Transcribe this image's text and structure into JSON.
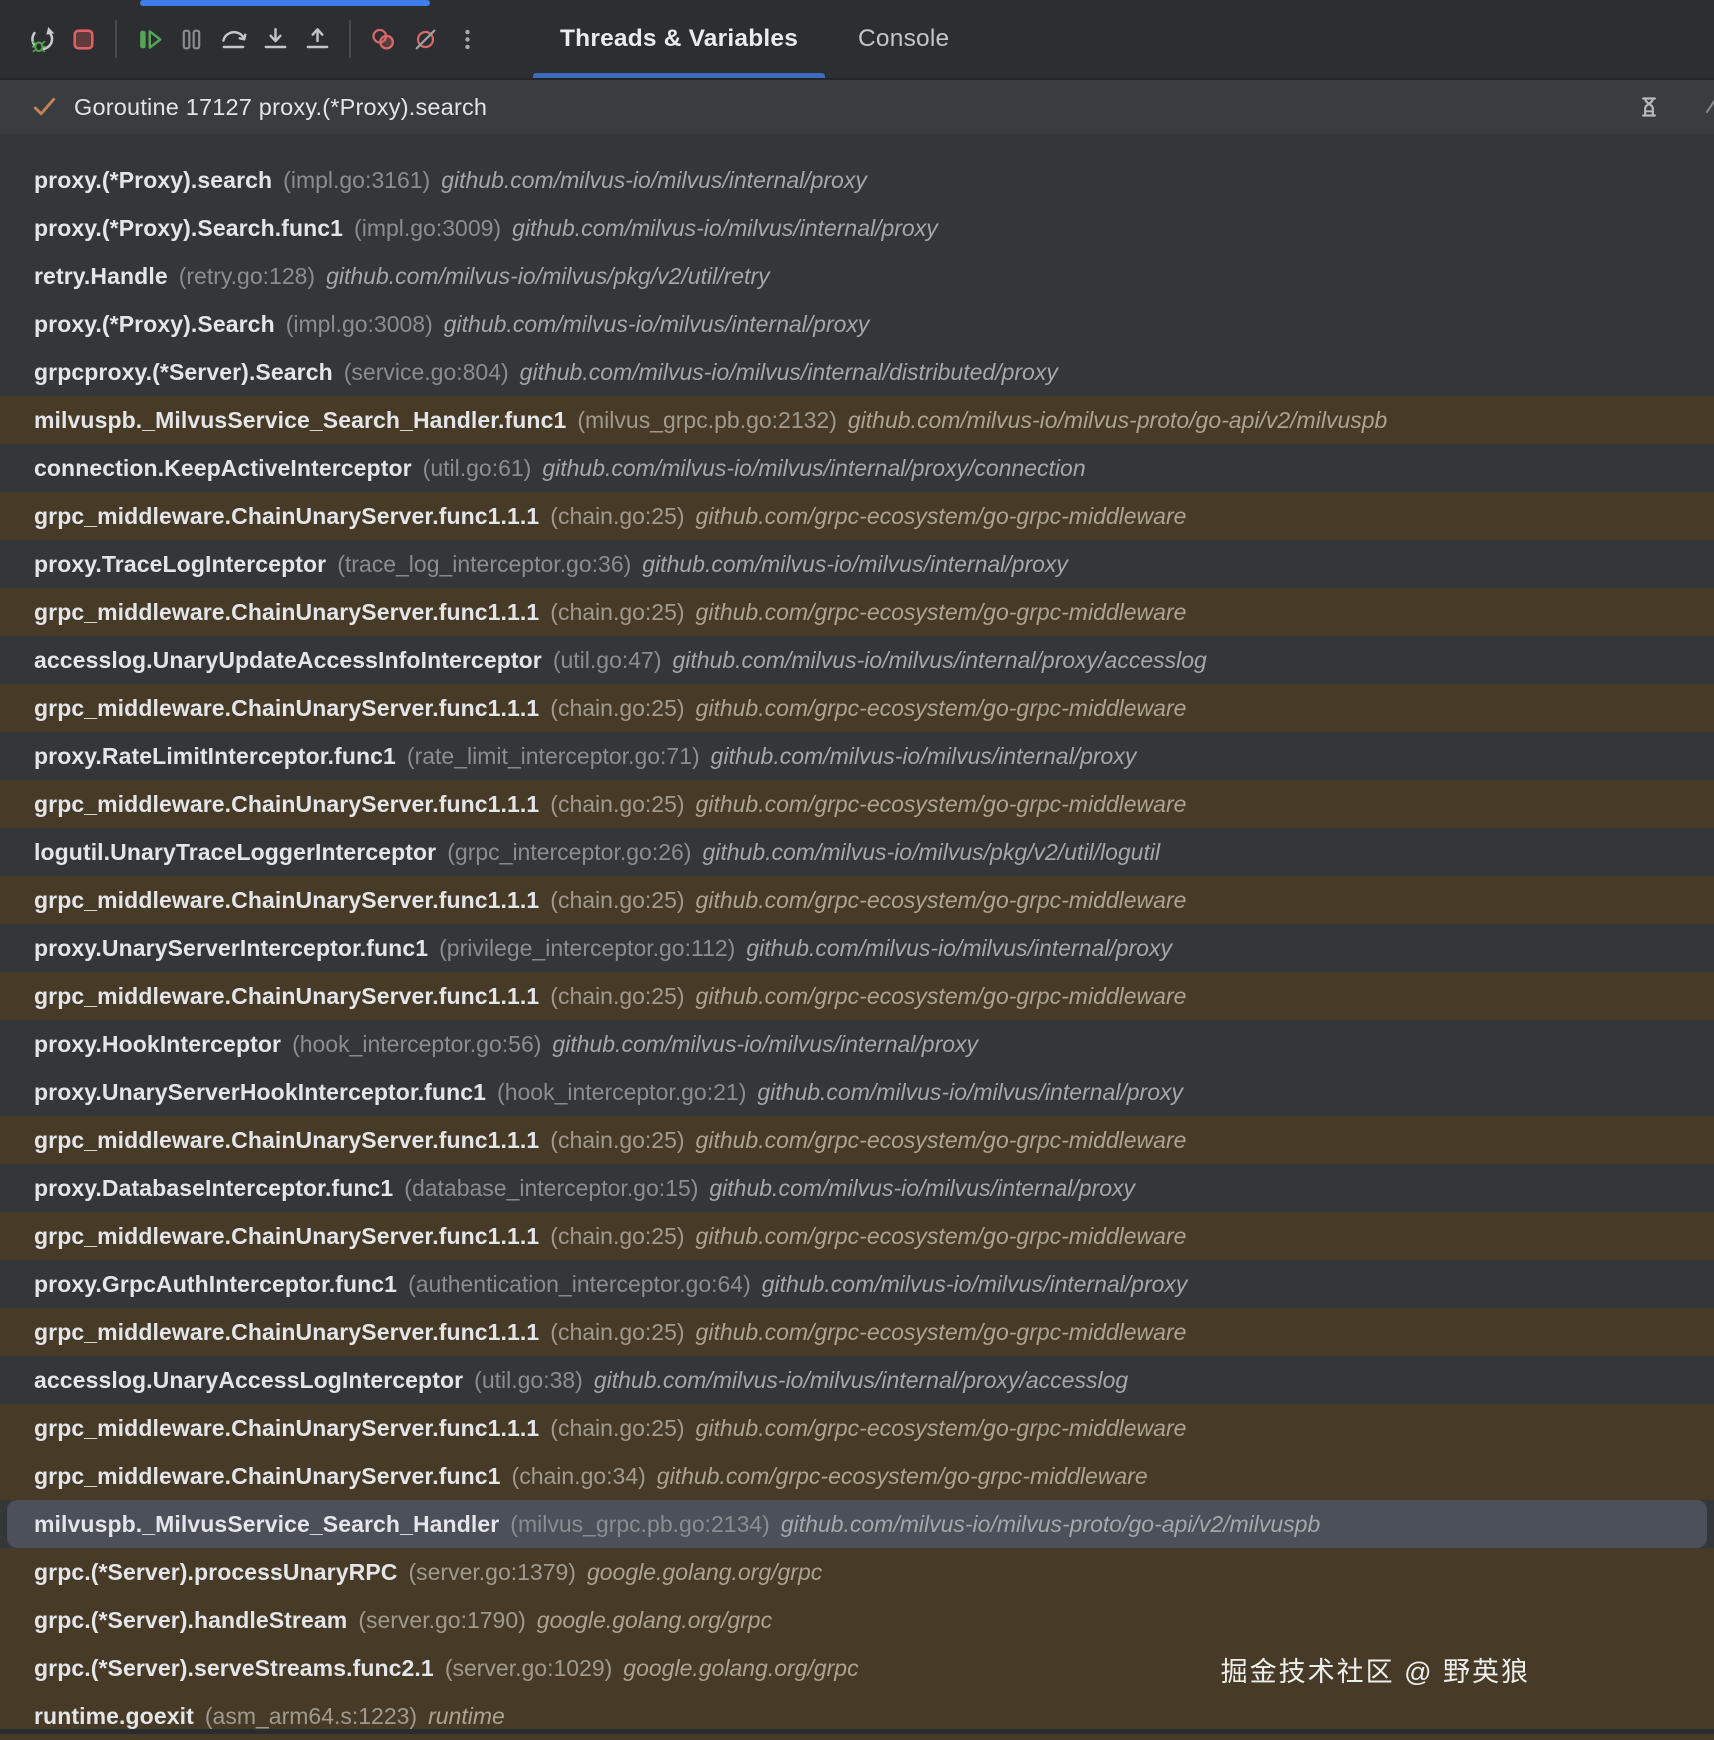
{
  "toolbar": {
    "icons": [
      "rerun-debug",
      "stop",
      "resume-program",
      "pause-program",
      "step-over",
      "step-into",
      "step-out",
      "view-breakpoints",
      "mute-breakpoints",
      "more-options"
    ],
    "tabs": [
      {
        "label": "Threads & Variables",
        "active": true
      },
      {
        "label": "Console",
        "active": false
      }
    ]
  },
  "goroutine_header": {
    "label": "Goroutine 17127 proxy.(*Proxy).search",
    "status_icon": "check-icon",
    "filter_icon": "hourglass-icon"
  },
  "frames": [
    {
      "fn": "proxy.(*Proxy).search",
      "loc": "(impl.go:3161)",
      "pkg": "github.com/milvus-io/milvus/internal/proxy",
      "bg": "dark"
    },
    {
      "fn": "proxy.(*Proxy).Search.func1",
      "loc": "(impl.go:3009)",
      "pkg": "github.com/milvus-io/milvus/internal/proxy",
      "bg": "dark"
    },
    {
      "fn": "retry.Handle",
      "loc": "(retry.go:128)",
      "pkg": "github.com/milvus-io/milvus/pkg/v2/util/retry",
      "bg": "dark"
    },
    {
      "fn": "proxy.(*Proxy).Search",
      "loc": "(impl.go:3008)",
      "pkg": "github.com/milvus-io/milvus/internal/proxy",
      "bg": "dark"
    },
    {
      "fn": "grpcproxy.(*Server).Search",
      "loc": "(service.go:804)",
      "pkg": "github.com/milvus-io/milvus/internal/distributed/proxy",
      "bg": "dark"
    },
    {
      "fn": "milvuspb._MilvusService_Search_Handler.func1",
      "loc": "(milvus_grpc.pb.go:2132)",
      "pkg": "github.com/milvus-io/milvus-proto/go-api/v2/milvuspb",
      "bg": "library"
    },
    {
      "fn": "connection.KeepActiveInterceptor",
      "loc": "(util.go:61)",
      "pkg": "github.com/milvus-io/milvus/internal/proxy/connection",
      "bg": "dark"
    },
    {
      "fn": "grpc_middleware.ChainUnaryServer.func1.1.1",
      "loc": "(chain.go:25)",
      "pkg": "github.com/grpc-ecosystem/go-grpc-middleware",
      "bg": "library"
    },
    {
      "fn": "proxy.TraceLogInterceptor",
      "loc": "(trace_log_interceptor.go:36)",
      "pkg": "github.com/milvus-io/milvus/internal/proxy",
      "bg": "dark"
    },
    {
      "fn": "grpc_middleware.ChainUnaryServer.func1.1.1",
      "loc": "(chain.go:25)",
      "pkg": "github.com/grpc-ecosystem/go-grpc-middleware",
      "bg": "library"
    },
    {
      "fn": "accesslog.UnaryUpdateAccessInfoInterceptor",
      "loc": "(util.go:47)",
      "pkg": "github.com/milvus-io/milvus/internal/proxy/accesslog",
      "bg": "dark"
    },
    {
      "fn": "grpc_middleware.ChainUnaryServer.func1.1.1",
      "loc": "(chain.go:25)",
      "pkg": "github.com/grpc-ecosystem/go-grpc-middleware",
      "bg": "library"
    },
    {
      "fn": "proxy.RateLimitInterceptor.func1",
      "loc": "(rate_limit_interceptor.go:71)",
      "pkg": "github.com/milvus-io/milvus/internal/proxy",
      "bg": "dark"
    },
    {
      "fn": "grpc_middleware.ChainUnaryServer.func1.1.1",
      "loc": "(chain.go:25)",
      "pkg": "github.com/grpc-ecosystem/go-grpc-middleware",
      "bg": "library"
    },
    {
      "fn": "logutil.UnaryTraceLoggerInterceptor",
      "loc": "(grpc_interceptor.go:26)",
      "pkg": "github.com/milvus-io/milvus/pkg/v2/util/logutil",
      "bg": "dark"
    },
    {
      "fn": "grpc_middleware.ChainUnaryServer.func1.1.1",
      "loc": "(chain.go:25)",
      "pkg": "github.com/grpc-ecosystem/go-grpc-middleware",
      "bg": "library"
    },
    {
      "fn": "proxy.UnaryServerInterceptor.func1",
      "loc": "(privilege_interceptor.go:112)",
      "pkg": "github.com/milvus-io/milvus/internal/proxy",
      "bg": "dark"
    },
    {
      "fn": "grpc_middleware.ChainUnaryServer.func1.1.1",
      "loc": "(chain.go:25)",
      "pkg": "github.com/grpc-ecosystem/go-grpc-middleware",
      "bg": "library"
    },
    {
      "fn": "proxy.HookInterceptor",
      "loc": "(hook_interceptor.go:56)",
      "pkg": "github.com/milvus-io/milvus/internal/proxy",
      "bg": "dark"
    },
    {
      "fn": "proxy.UnaryServerHookInterceptor.func1",
      "loc": "(hook_interceptor.go:21)",
      "pkg": "github.com/milvus-io/milvus/internal/proxy",
      "bg": "dark"
    },
    {
      "fn": "grpc_middleware.ChainUnaryServer.func1.1.1",
      "loc": "(chain.go:25)",
      "pkg": "github.com/grpc-ecosystem/go-grpc-middleware",
      "bg": "library"
    },
    {
      "fn": "proxy.DatabaseInterceptor.func1",
      "loc": "(database_interceptor.go:15)",
      "pkg": "github.com/milvus-io/milvus/internal/proxy",
      "bg": "dark"
    },
    {
      "fn": "grpc_middleware.ChainUnaryServer.func1.1.1",
      "loc": "(chain.go:25)",
      "pkg": "github.com/grpc-ecosystem/go-grpc-middleware",
      "bg": "library"
    },
    {
      "fn": "proxy.GrpcAuthInterceptor.func1",
      "loc": "(authentication_interceptor.go:64)",
      "pkg": "github.com/milvus-io/milvus/internal/proxy",
      "bg": "dark"
    },
    {
      "fn": "grpc_middleware.ChainUnaryServer.func1.1.1",
      "loc": "(chain.go:25)",
      "pkg": "github.com/grpc-ecosystem/go-grpc-middleware",
      "bg": "library"
    },
    {
      "fn": "accesslog.UnaryAccessLogInterceptor",
      "loc": "(util.go:38)",
      "pkg": "github.com/milvus-io/milvus/internal/proxy/accesslog",
      "bg": "dark"
    },
    {
      "fn": "grpc_middleware.ChainUnaryServer.func1.1.1",
      "loc": "(chain.go:25)",
      "pkg": "github.com/grpc-ecosystem/go-grpc-middleware",
      "bg": "library"
    },
    {
      "fn": "grpc_middleware.ChainUnaryServer.func1",
      "loc": "(chain.go:34)",
      "pkg": "github.com/grpc-ecosystem/go-grpc-middleware",
      "bg": "library"
    },
    {
      "fn": "milvuspb._MilvusService_Search_Handler",
      "loc": "(milvus_grpc.pb.go:2134)",
      "pkg": "github.com/milvus-io/milvus-proto/go-api/v2/milvuspb",
      "bg": "selected"
    },
    {
      "fn": "grpc.(*Server).processUnaryRPC",
      "loc": "(server.go:1379)",
      "pkg": "google.golang.org/grpc",
      "bg": "library"
    },
    {
      "fn": "grpc.(*Server).handleStream",
      "loc": "(server.go:1790)",
      "pkg": "google.golang.org/grpc",
      "bg": "library"
    },
    {
      "fn": "grpc.(*Server).serveStreams.func2.1",
      "loc": "(server.go:1029)",
      "pkg": "google.golang.org/grpc",
      "bg": "library"
    },
    {
      "fn": "runtime.goexit",
      "loc": "(asm_arm64.s:1223)",
      "pkg": "runtime",
      "bg": "library"
    }
  ],
  "watermark": {
    "text": "掘金技术社区 @ 野英狼"
  },
  "colors": {
    "toolbar_bg": "#2c2e31",
    "header_bg": "#3a3d40",
    "row_bg": "#34373a",
    "library_frame_bg": "#473b28",
    "selected_frame_bg": "#4b505a",
    "accent_blue": "#3f7ee8",
    "tab_underline_blue": "#3d6bc0",
    "function_text": "#e3e5e9",
    "location_text": "#8a8d91",
    "package_text": "#a4a7ab",
    "check_orange": "#c38158",
    "stop_red": "#e05f5f",
    "breakpoint_red": "#d96a6a",
    "resume_green": "#55a556"
  }
}
